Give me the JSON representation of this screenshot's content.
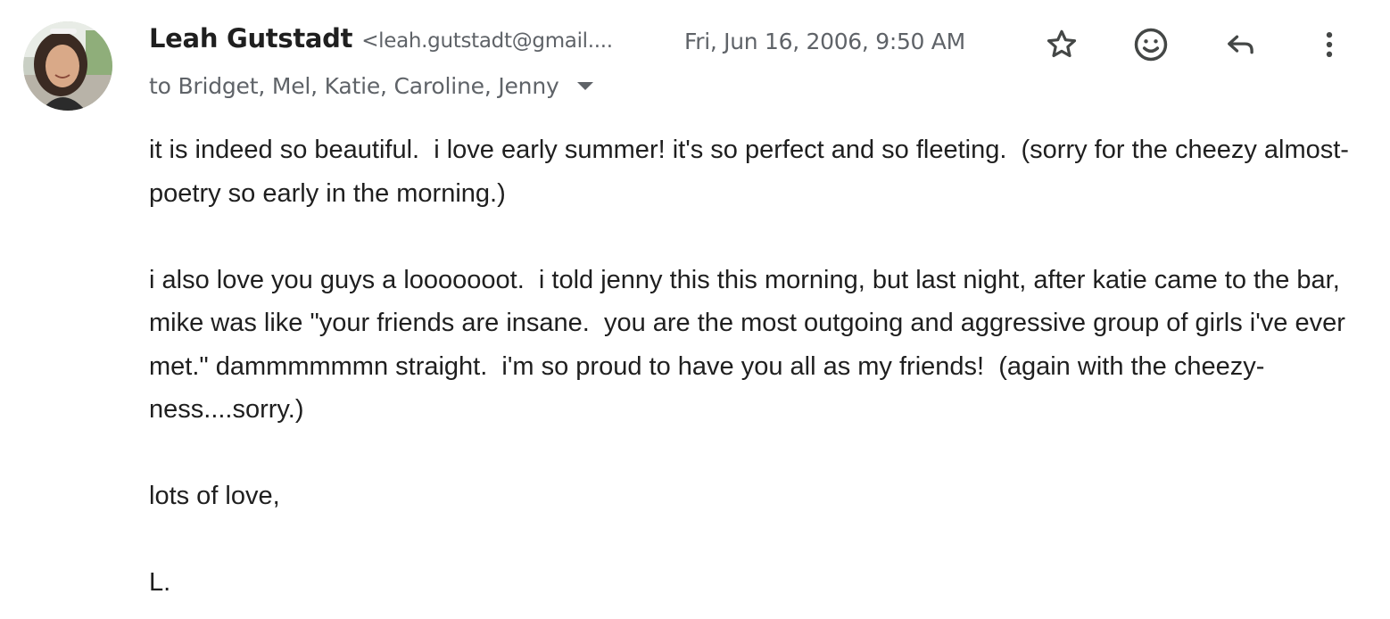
{
  "email": {
    "sender": {
      "name": "Leah Gutstadt",
      "email": "<leah.gutstadt@gmail...."
    },
    "date": "Fri, Jun 16, 2006, 9:50 AM",
    "recipients": "to Bridget, Mel, Katie, Caroline, Jenny",
    "body": {
      "paragraph_1": "it is indeed so beautiful.  i love early summer! it's so perfect and so fleeting.  (sorry for the cheezy almost-poetry so early in the morning.)",
      "paragraph_2": "i also love you guys a looooooot.  i told jenny this this morning, but last night, after katie came to the bar, mike was like \"your friends are insane.  you are the most outgoing and aggressive group of girls i've ever met.\" dammmmmmn straight.  i'm so proud to have you all as my friends!  (again with the cheezy-ness....sorry.)",
      "closing": "lots of love,",
      "signature": "L."
    }
  },
  "toolbar": {
    "icons": [
      "star-icon",
      "emoji-icon",
      "reply-icon",
      "more-vert-icon"
    ]
  },
  "colors": {
    "text_primary": "#1f1f1f",
    "text_secondary": "#5f6368",
    "icon": "#444746"
  }
}
